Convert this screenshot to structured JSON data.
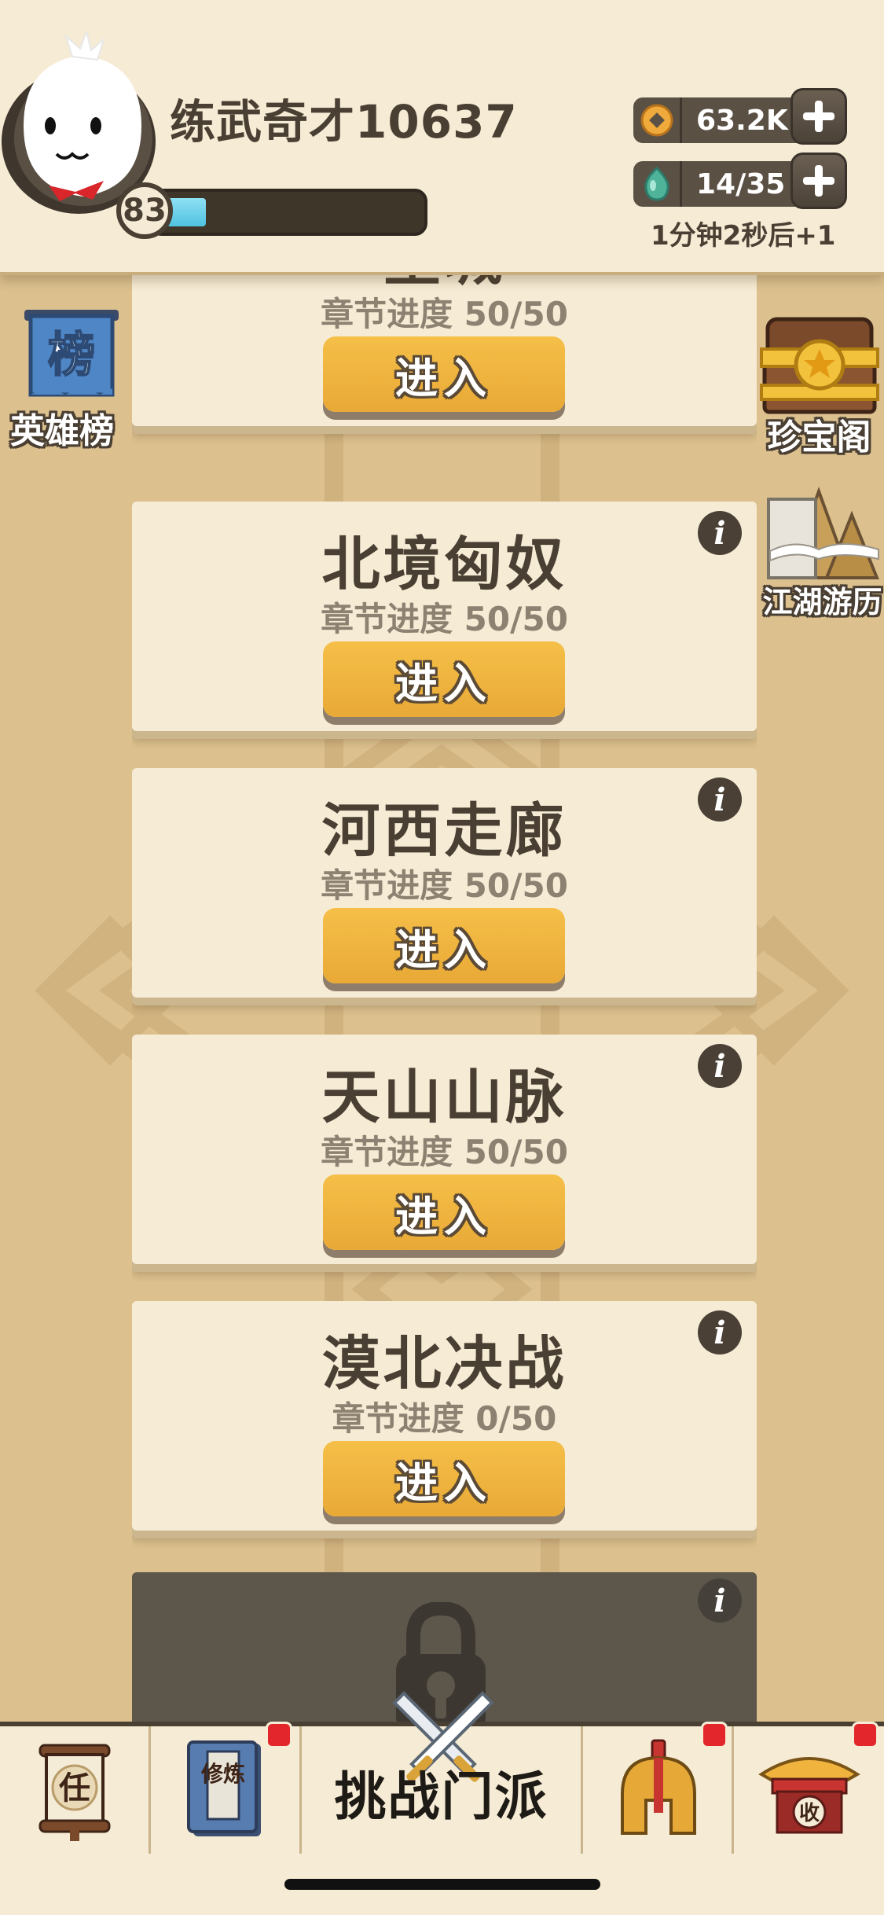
{
  "player": {
    "name": "练武奇才10637",
    "level": "83",
    "exp_fraction": 0.16
  },
  "resources": {
    "coins": "63.2K",
    "stamina": "14/35",
    "regen_text": "1分钟2秒后+1"
  },
  "side_buttons": {
    "left": {
      "label": "英雄榜",
      "icon_text": "榜"
    },
    "right_top": {
      "label": "珍宝阁"
    },
    "right_bottom": {
      "label": "江湖游历"
    }
  },
  "chapters": [
    {
      "title": "皇城",
      "progress": "章节进度 50/50",
      "button": "进入"
    },
    {
      "title": "北境匈奴",
      "progress": "章节进度 50/50",
      "button": "进入"
    },
    {
      "title": "河西走廊",
      "progress": "章节进度 50/50",
      "button": "进入"
    },
    {
      "title": "天山山脉",
      "progress": "章节进度 50/50",
      "button": "进入"
    },
    {
      "title": "漠北决战",
      "progress": "章节进度 0/50",
      "button": "进入"
    }
  ],
  "info_icon_text": "i",
  "bottom_nav": {
    "task_icon_text": "任",
    "cultivate_icon_text": "修炼",
    "center_label": "挑战门派",
    "collect_icon_text": "收"
  },
  "colors": {
    "background": "#dcc08e",
    "card": "#f6ebd4",
    "button": "#f0b43e",
    "text_dark": "#4a3f33",
    "badge_red": "#e2262b",
    "exp_fill": "#4fc3e0"
  }
}
